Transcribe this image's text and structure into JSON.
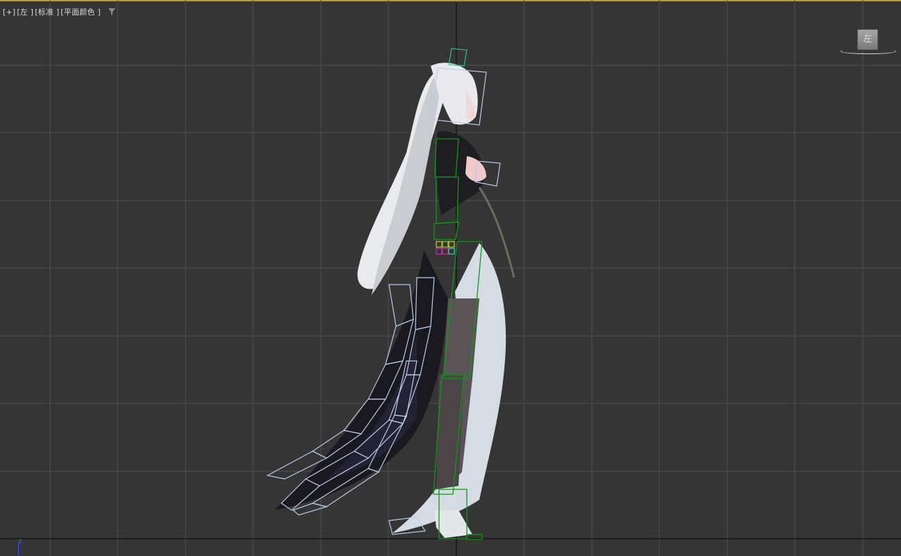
{
  "viewport": {
    "labels": {
      "plus": "[+]",
      "view": "[左 ]",
      "shading": "[标准 ]",
      "display": "[平面颜色 ]"
    },
    "viewcube_face": "左",
    "axis_label": "Z"
  },
  "colors": {
    "background": "#353535",
    "grid": "#4e4e4e",
    "axis": "#0d0d0d",
    "active_border": "#b59a43",
    "bone": "#0a9b12",
    "hair_outline": "#b9cde6"
  },
  "icons": [
    "filter-icon",
    "viewcube-icon",
    "axis-z-icon"
  ]
}
